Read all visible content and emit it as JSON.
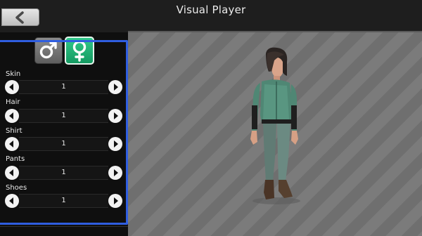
{
  "header": {
    "title": "Visual Player",
    "back_icon": "arrow-left-icon"
  },
  "gender_selector": {
    "male_icon": "male-symbol-icon",
    "female_icon": "female-symbol-icon",
    "selected": "female",
    "colors": {
      "female_bg": "#1faa70",
      "male_bg": "#777777"
    }
  },
  "options": [
    {
      "label": "Skin",
      "value": "1"
    },
    {
      "label": "Hair",
      "value": "1"
    },
    {
      "label": "Shirt",
      "value": "1"
    },
    {
      "label": "Pants",
      "value": "1"
    },
    {
      "label": "Shoes",
      "value": "1"
    }
  ],
  "accent_color": "#2f5ee0"
}
